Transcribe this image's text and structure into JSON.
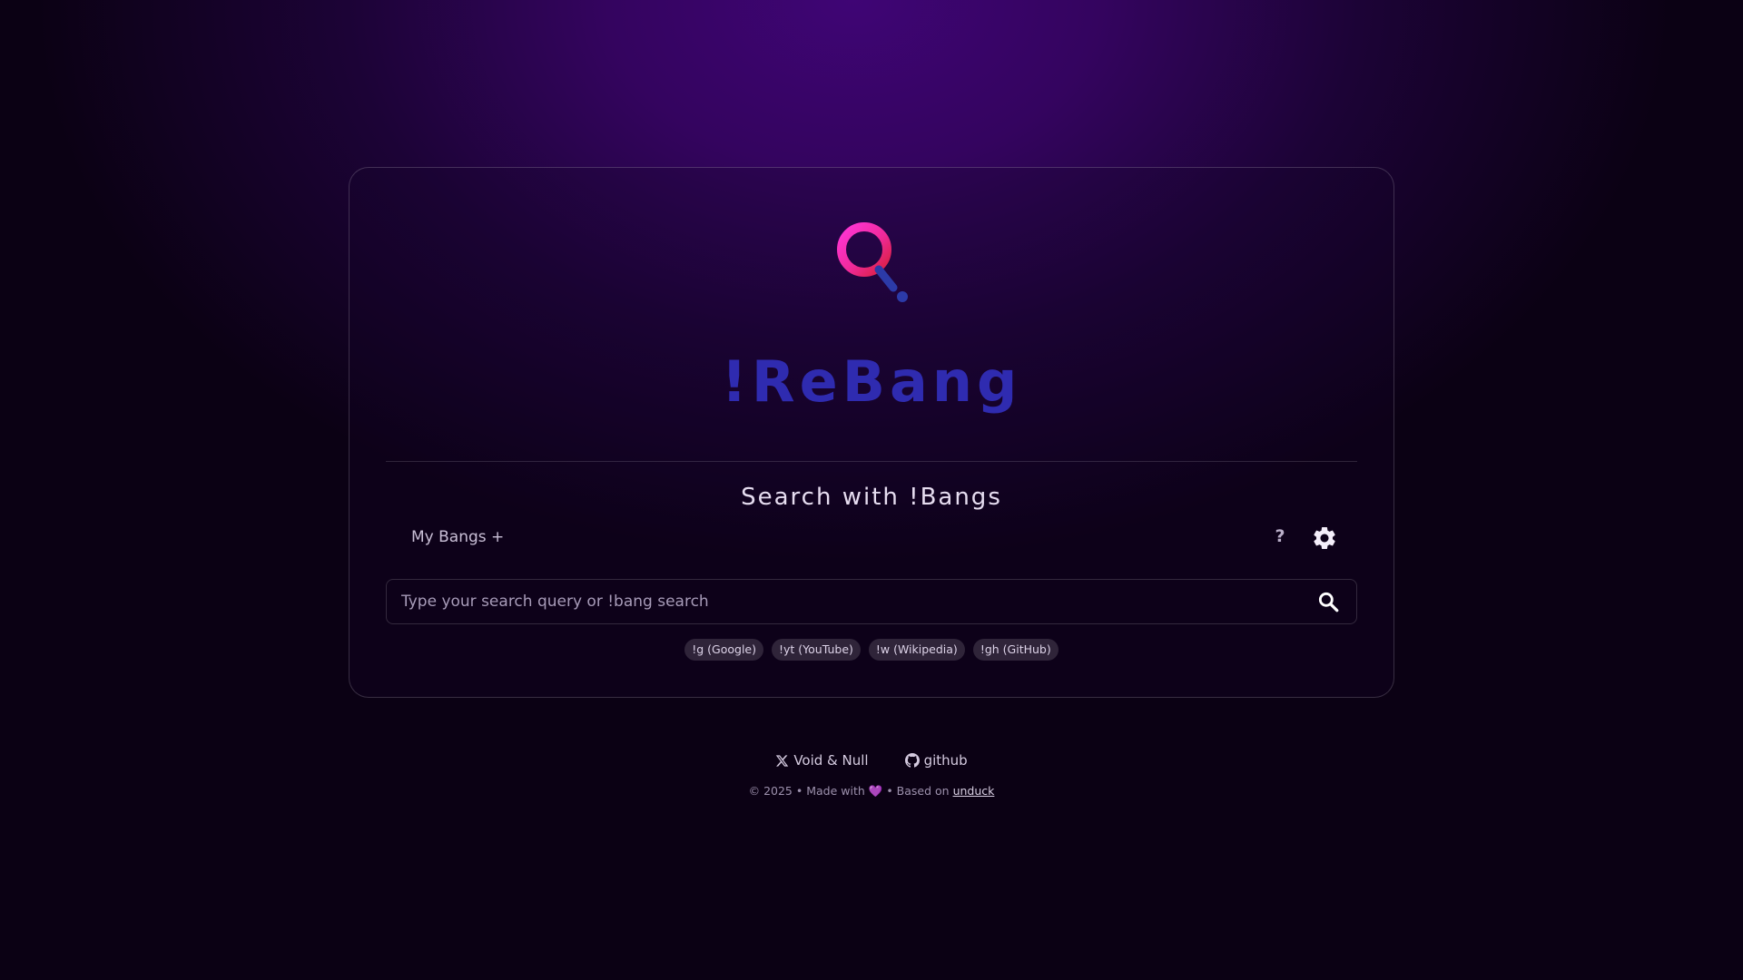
{
  "brand": {
    "title": "!ReBang",
    "logo_icon": "magnifier-logo-icon",
    "colors": {
      "title": "#2f2bb0",
      "ring_start": "#ff2fd6",
      "ring_end": "#e0203f",
      "handle": "#2c3aa8"
    }
  },
  "main": {
    "subtitle": "Search with !Bangs",
    "my_bangs_label": "My Bangs +",
    "help_label": "?",
    "settings_icon": "gear-icon",
    "search": {
      "placeholder": "Type your search query or !bang search",
      "value": "",
      "button_icon": "search-icon"
    },
    "quick_bangs": [
      {
        "label": "!g (Google)"
      },
      {
        "label": "!yt (YouTube)"
      },
      {
        "label": "!w (Wikipedia)"
      },
      {
        "label": "!gh (GitHub)"
      }
    ]
  },
  "footer": {
    "links": [
      {
        "icon": "x-icon",
        "label": "Void & Null"
      },
      {
        "icon": "github-icon",
        "label": "github"
      }
    ],
    "copyright_prefix": "© 2025 • Made with",
    "heart": "💜",
    "based_on_text": "• Based on",
    "based_on_link": "unduck"
  }
}
